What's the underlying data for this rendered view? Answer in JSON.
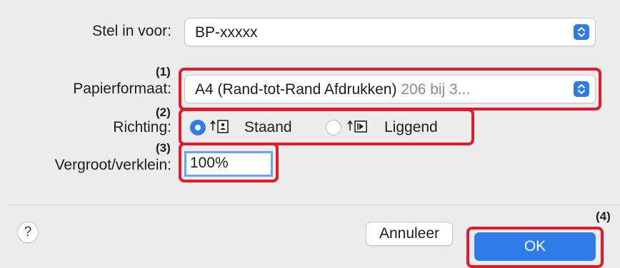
{
  "form": {
    "printer_label": "Stel in voor:",
    "printer_value": "BP-xxxxx",
    "paper_label": "Papierformaat:",
    "paper_value": "A4 (Rand-tot-Rand Afdrukken)",
    "paper_size_detail": "206 bij 3...",
    "orientation_label": "Richting:",
    "orientation_options": [
      {
        "label": "Staand",
        "selected": true,
        "icon": "portrait-orientation-icon"
      },
      {
        "label": "Liggend",
        "selected": false,
        "icon": "landscape-orientation-icon"
      }
    ],
    "scale_label": "Vergroot/verklein:",
    "scale_value": "100%"
  },
  "annotations": [
    "(1)",
    "(2)",
    "(3)",
    "(4)"
  ],
  "footer": {
    "help_label": "?",
    "cancel_label": "Annuleer",
    "ok_label": "OK"
  },
  "colors": {
    "accent": "#2f7be8",
    "highlight": "#e6192a",
    "background": "#ececec"
  }
}
